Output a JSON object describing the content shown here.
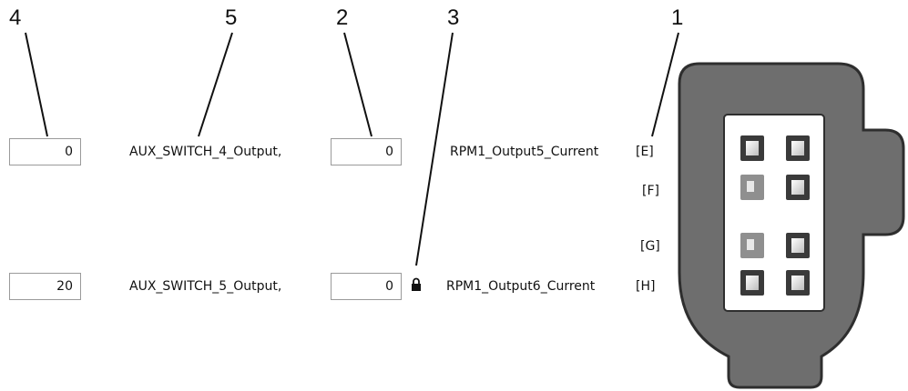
{
  "callouts": {
    "c1": "1",
    "c2": "2",
    "c3": "3",
    "c4": "4",
    "c5": "5"
  },
  "rows": [
    {
      "value_left": "0",
      "switch_label": "AUX_SWITCH_4_Output,",
      "value_right": "0",
      "current_label": "RPM1_Output5_Current",
      "pin": "[E]"
    },
    {
      "value_left": "20",
      "switch_label": "AUX_SWITCH_5_Output,",
      "value_right": "0",
      "current_label": "RPM1_Output6_Current",
      "pin": "[H]"
    }
  ],
  "extra_pins": {
    "f": "[F]",
    "g": "[G]"
  },
  "icons": {
    "lock": "lock-icon"
  },
  "colors": {
    "connector_body": "#6e6e6e",
    "connector_outline": "#2e2e2e",
    "inset": "#ffffff",
    "pin_active": "#3a3a3a",
    "pin_inactive": "#8f8f8f"
  }
}
